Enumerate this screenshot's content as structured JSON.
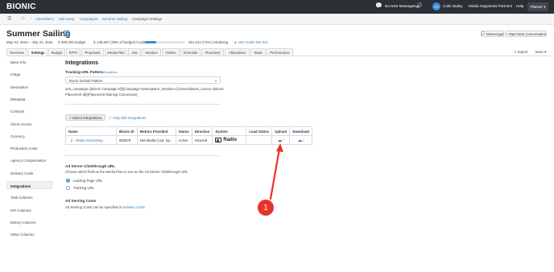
{
  "topbar": {
    "logo": "BIONIC",
    "no_new_messages": "No New Messages",
    "user_initials": "CD",
    "user_name": "Colin Dailey",
    "org": "Media Happiness Partners",
    "help": "Help",
    "planner": "Planner"
  },
  "breadcrumb": [
    "Advertisers",
    "Sail Away",
    "Campaigns",
    "Summer Sailing",
    "Campaign Settings"
  ],
  "campaign": {
    "title": "Summer Sailing",
    "dates": "May 01, 2024 – July 31, 2024",
    "budget": "500,000 budget",
    "in_plan": "138,687 (28% of budget) in plan",
    "remaining": "361,313 (72%) remaining",
    "in_plan_fraction": 0.28,
    "goal": "OKI Goals Not Set"
  },
  "actions": {
    "messenger": "Messenger",
    "start_conversation": "Start New Conversation",
    "export": "Export",
    "more": "More"
  },
  "tabs": [
    "Overview",
    "Settings",
    "Budget",
    "RFPs",
    "Proposals",
    "Media Plan",
    "Ads",
    "Vendors",
    "Orders",
    "Schedule",
    "Flowchart",
    "Allocations",
    "Tasks",
    "Performance"
  ],
  "active_tab": "Settings",
  "sidebar": [
    "Basic Info",
    "Image",
    "Description",
    "Metadata",
    "Contacts",
    "Client Access",
    "Currency",
    "Production Costs",
    "Agency Compensation",
    "Delivery Costs",
    "Integrations",
    "Task Columns",
    "KPI Columns",
    "Money Columns",
    "Other Columns"
  ],
  "active_side": "Integrations",
  "integrations": {
    "heading": "Integrations",
    "tracking_label": "Tracking URL Pattern",
    "edit_patterns": "edit patterns",
    "select_value": "Bionic Default Pattern",
    "pattern_line1": "utm_campaign={Bionic Campaign Id}|{Campaign Name}&utm_medium={Channel}&utm_source={Bionic",
    "pattern_line2": "Placement Id}|{Placement Naming Convention}",
    "select_btn": "Select Integrations",
    "help_link": "Help with Integrations",
    "columns": [
      "Name",
      "Bionic ID",
      "Metrics Provided",
      "Status",
      "Direction",
      "System",
      "Load Status",
      "Upload",
      "Download"
    ],
    "rows": [
      {
        "num": "1",
        "name": "Radio Advertising",
        "id": "883578",
        "metrics": "Net Media Cost, Sp...",
        "status": "Active",
        "direction": "Inbound",
        "system": "Radio",
        "load_status": ""
      }
    ],
    "clickthrough_label": "Ad Server Clickthrough URL",
    "clickthrough_desc": "Choose which field on the Media Plan to use as the Ad Server Clickthrough URL",
    "opt_landing": "Landing Page URL",
    "opt_tracking": "Tracking URL",
    "serving_label": "Ad Serving Costs",
    "serving_desc": "Ad Serving Costs can be specified in",
    "serving_link": "Delivery Costs"
  },
  "annotation": {
    "number": "1",
    "color": "#e8332a"
  }
}
